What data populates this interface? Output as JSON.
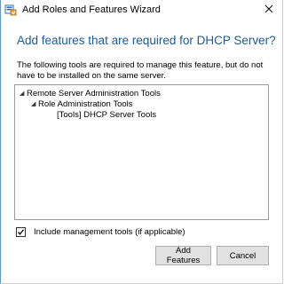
{
  "window": {
    "title": "Add Roles and Features Wizard",
    "title_icon": "server-manager-icon",
    "close_icon": "close-icon"
  },
  "heading": "Add features that are required for DHCP Server?",
  "description": "The following tools are required to manage this feature, but do not have to be installed on the same server.",
  "tree": {
    "items": [
      {
        "label": "Remote Server Administration Tools",
        "level": 0,
        "expanded": true
      },
      {
        "label": "Role Administration Tools",
        "level": 1,
        "expanded": true
      },
      {
        "label": "[Tools] DHCP Server Tools",
        "level": 2,
        "expanded": false
      }
    ]
  },
  "checkbox": {
    "label": "Include management tools (if applicable)",
    "checked": true
  },
  "buttons": {
    "add_label": "Add Features",
    "cancel_label": "Cancel"
  },
  "colors": {
    "heading": "#1e5a9a",
    "window_border": "#5a9bd5",
    "button_bg": "#e1e1e1"
  }
}
